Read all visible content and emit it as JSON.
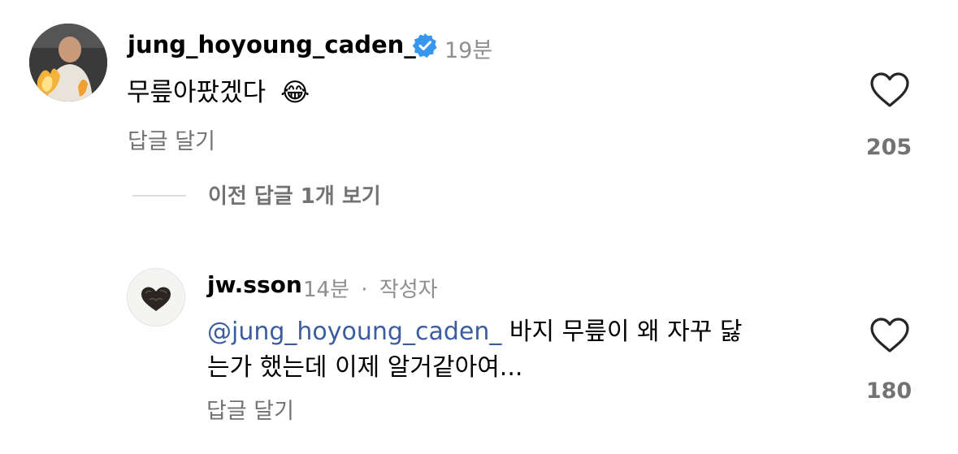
{
  "comments": [
    {
      "username": "jung_hoyoung_caden_",
      "verified": true,
      "time": "19분",
      "text": "무릎아팠겠다",
      "emoji": "😂",
      "reply_label": "답글 달기",
      "likes": "205"
    }
  ],
  "thread": {
    "view_previous_label": "이전 답글 1개 보기"
  },
  "replies": [
    {
      "username": "jw.sson",
      "time": "14분",
      "separator": "·",
      "author_badge": "작성자",
      "mention": "@jung_hoyoung_caden_",
      "text_line1": " 바지 무릎이 왜 자꾸 닳",
      "text_line2": "는가 했는데 이제 알거같아여...",
      "reply_label": "답글 달기",
      "likes": "180"
    }
  ],
  "colors": {
    "verified_badge": "#3797f0",
    "mention": "#3b5d9e",
    "secondary_text": "#737373"
  },
  "icons": {
    "like": "heart-outline-icon",
    "verified": "verified-badge-icon"
  }
}
